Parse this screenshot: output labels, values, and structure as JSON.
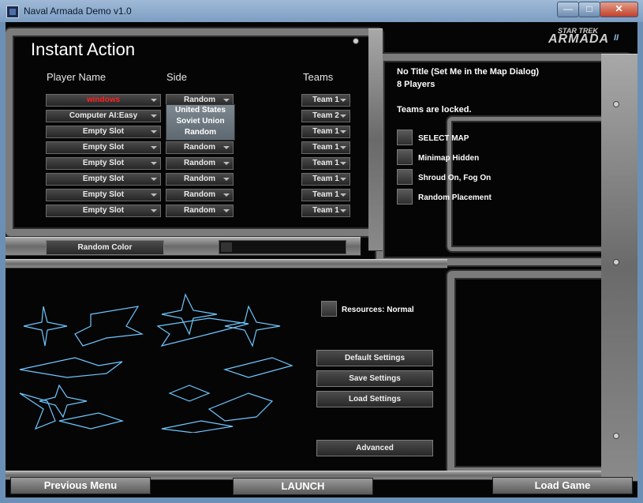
{
  "window": {
    "title": "Naval Armada Demo v1.0",
    "controls": [
      "—",
      "□",
      "✕"
    ]
  },
  "logo": {
    "top": "STAR TREK",
    "bottom": "ARMADA",
    "numeral": "II"
  },
  "heading": "Instant Action",
  "columns": {
    "player": "Player Name",
    "side": "Side",
    "teams": "Teams"
  },
  "players": [
    {
      "name": "windows",
      "side": "Random",
      "team": "Team 1",
      "color": "#ff2020"
    },
    {
      "name": "Computer AI:Easy",
      "side": "",
      "team": "Team 2",
      "color": "#eaeaea"
    },
    {
      "name": "Empty Slot",
      "side": "",
      "team": "Team 1",
      "color": "#eaeaea"
    },
    {
      "name": "Empty Slot",
      "side": "Random",
      "team": "Team 1",
      "color": "#eaeaea"
    },
    {
      "name": "Empty Slot",
      "side": "Random",
      "team": "Team 1",
      "color": "#eaeaea"
    },
    {
      "name": "Empty Slot",
      "side": "Random",
      "team": "Team 1",
      "color": "#eaeaea"
    },
    {
      "name": "Empty Slot",
      "side": "Random",
      "team": "Team 1",
      "color": "#eaeaea"
    },
    {
      "name": "Empty Slot",
      "side": "Random",
      "team": "Team 1",
      "color": "#eaeaea"
    }
  ],
  "side_dropdown": [
    "United States",
    "Soviet Union",
    "Random"
  ],
  "random_color_label": "Random Color",
  "map_info": {
    "title": "No Title (Set Me in the Map Dialog)",
    "players": "8 Players",
    "locked": "Teams are locked."
  },
  "options": [
    {
      "label": "SELECT MAP"
    },
    {
      "label": "Minimap Hidden"
    },
    {
      "label": "Shroud On, Fog On"
    },
    {
      "label": "Random Placement"
    }
  ],
  "resources_label": "Resources: Normal",
  "settings_buttons": {
    "default": "Default Settings",
    "save": "Save Settings",
    "load": "Load Settings",
    "advanced": "Advanced"
  },
  "bottom": {
    "previous": "Previous Menu",
    "launch": "LAUNCH",
    "load_game": "Load Game"
  },
  "colors": {
    "accent": "#6ec7ff",
    "slot_red": "#ff2020"
  }
}
